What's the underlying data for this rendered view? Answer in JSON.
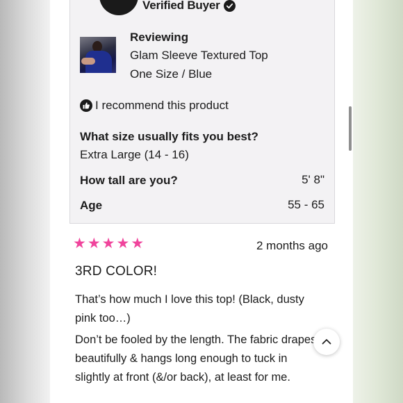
{
  "reviewer": {
    "verified_label": "Verified Buyer"
  },
  "reviewing": {
    "label": "Reviewing",
    "product_name": "Glam Sleeve Textured Top",
    "variant": "One Size / Blue"
  },
  "recommend_text": "I recommend this product",
  "attributes": {
    "size_question": "What size usually fits you best?",
    "size_answer": "Extra Large (14 - 16)",
    "height_question": "How tall are you?",
    "height_answer": "5' 8\"",
    "age_question": "Age",
    "age_answer": "55 - 65"
  },
  "review": {
    "rating": 5,
    "time_ago": "2 months ago",
    "title": "3RD COLOR!",
    "paragraph_1": "That’s how much I love this top! (Black, dusty pink too…)",
    "paragraph_2": "Don’t be fooled by the length. The fabric drapes beautifully & hangs long enough to tuck in slightly at front (&/or back), at least for me."
  },
  "colors": {
    "star": "#f0449c",
    "panel_bg": "#f3f2f4",
    "text": "#1b1b1b"
  },
  "icons": {
    "verified": "check-circle-icon",
    "recommend": "thumbs-up-icon",
    "scroll_top": "chevron-up-icon"
  }
}
